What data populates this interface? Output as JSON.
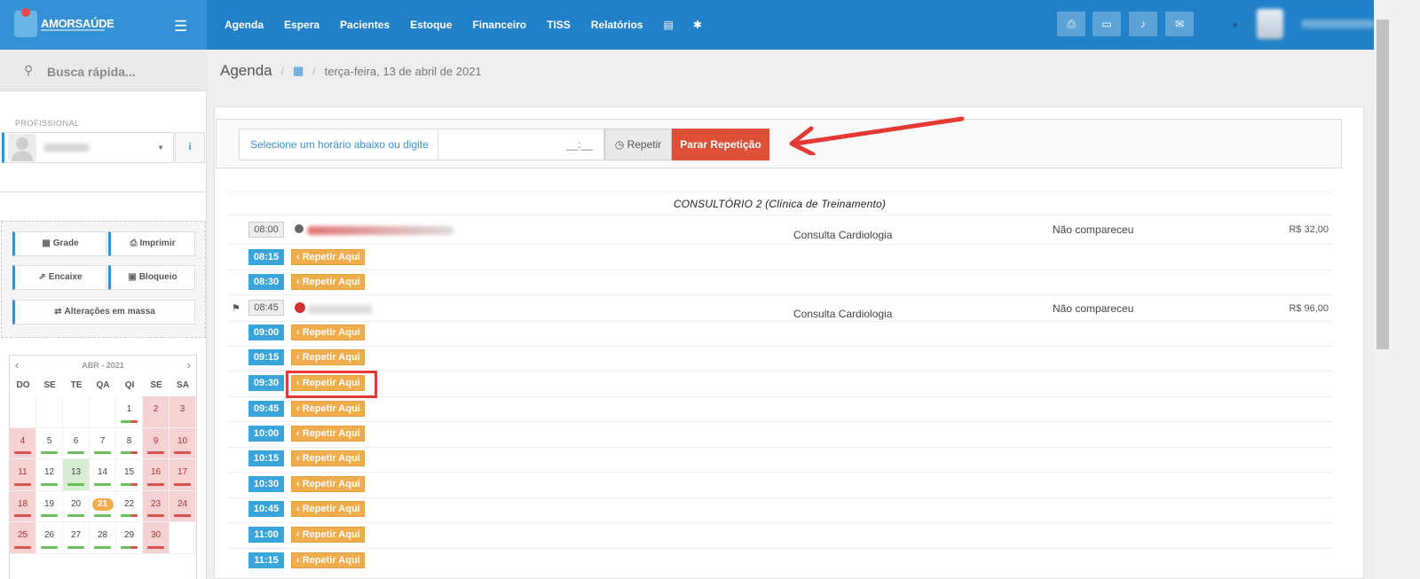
{
  "brand": {
    "name": "AMORSAÚDE"
  },
  "nav": [
    "Agenda",
    "Espera",
    "Pacientes",
    "Estoque",
    "Financeiro",
    "TISS",
    "Relatórios"
  ],
  "sidebar": {
    "quick_search": "Busca rápida...",
    "profissional_label": "PROFISSIONAL",
    "actions": {
      "grade": "Grade",
      "imprimir": "Imprimir",
      "encaixe": "Encaixe",
      "bloqueio": "Bloqueio",
      "massa": "Alterações em massa"
    }
  },
  "calendar": {
    "title": "ABR - 2021",
    "weekdays": [
      "DO",
      "SE",
      "TE",
      "QA",
      "QI",
      "SE",
      "SA"
    ],
    "today": 21,
    "weeks": [
      [
        "",
        "",
        "",
        "",
        "1",
        "2",
        "3"
      ],
      [
        "4",
        "5",
        "6",
        "7",
        "8",
        "9",
        "10"
      ],
      [
        "11",
        "12",
        "13",
        "14",
        "15",
        "16",
        "17"
      ],
      [
        "18",
        "19",
        "20",
        "21",
        "22",
        "23",
        "24"
      ],
      [
        "25",
        "26",
        "27",
        "28",
        "29",
        "30",
        ""
      ]
    ]
  },
  "breadcrumb": {
    "title": "Agenda",
    "date": "terça-feira, 13 de abril de 2021"
  },
  "toolbar": {
    "select_label": "Selecione um horário abaixo ou digite",
    "time_placeholder": "__:__",
    "repetir": "Repetir",
    "parar": "Parar Repetição"
  },
  "room": "CONSULTÓRIO 2 (Clínica de Treinamento)",
  "repeat_label": "Repetir Aqui",
  "rows": [
    {
      "time": "08:00",
      "booked": true,
      "procedure": "Consulta Cardiologia",
      "status": "Não compareceu",
      "price": "R$ 32,00"
    },
    {
      "time": "08:15"
    },
    {
      "time": "08:30"
    },
    {
      "time": "08:45",
      "booked": true,
      "flag": true,
      "procedure": "Consulta Cardiologia",
      "status": "Não compareceu",
      "price": "R$ 96,00"
    },
    {
      "time": "09:00"
    },
    {
      "time": "09:15"
    },
    {
      "time": "09:30"
    },
    {
      "time": "09:45"
    },
    {
      "time": "10:00"
    },
    {
      "time": "10:15"
    },
    {
      "time": "10:30"
    },
    {
      "time": "10:45"
    },
    {
      "time": "11:00"
    },
    {
      "time": "11:15"
    }
  ]
}
